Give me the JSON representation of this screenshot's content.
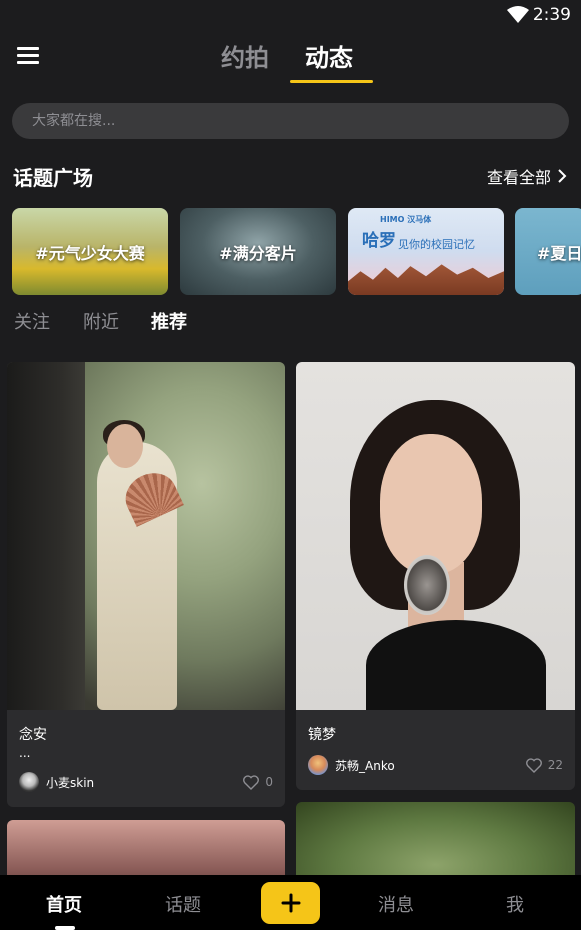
{
  "status": {
    "time": "2:39"
  },
  "header": {
    "tabs": [
      {
        "label": "约拍",
        "active": false
      },
      {
        "label": "动态",
        "active": true
      }
    ],
    "accent_color": "#f5c518"
  },
  "search": {
    "placeholder": "大家都在搜..."
  },
  "topics_section": {
    "title": "话题广场",
    "view_all_label": "查看全部",
    "cards": [
      {
        "label": "#元气少女大赛"
      },
      {
        "label": "#满分客片"
      },
      {
        "label": "",
        "brand": "HIMO 汉马体",
        "headline": "哈罗",
        "subline": "见你的校园记忆"
      },
      {
        "label": "#夏日"
      }
    ]
  },
  "feed_tabs": [
    {
      "label": "关注",
      "active": false
    },
    {
      "label": "附近",
      "active": false
    },
    {
      "label": "推荐",
      "active": true
    }
  ],
  "posts": [
    {
      "title": "念安",
      "desc": "...",
      "author": "小麦skin",
      "likes": "0"
    },
    {
      "title": "镜梦",
      "desc": "",
      "author": "苏畅_Anko",
      "likes": "22"
    }
  ],
  "bottom_nav": {
    "home": "首页",
    "topics": "话题",
    "add_icon": "plus-icon",
    "messages": "消息",
    "me": "我"
  }
}
